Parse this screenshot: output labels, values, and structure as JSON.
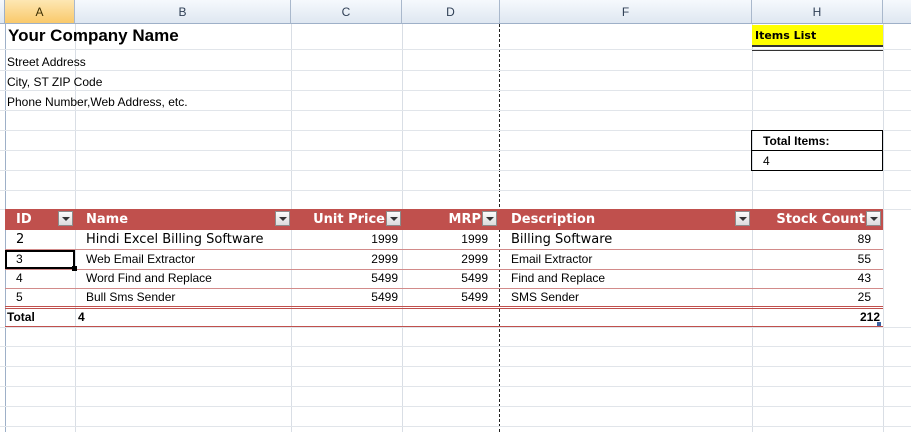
{
  "columns": [
    "A",
    "B",
    "C",
    "D",
    "F",
    "H"
  ],
  "company": {
    "name": "Your Company Name",
    "street": "Street Address",
    "city": "City, ST  ZIP Code",
    "phone": "Phone Number,Web Address, etc."
  },
  "items_list_label": "Items List",
  "total_items": {
    "label": "Total Items:",
    "value": "4"
  },
  "table": {
    "headers": {
      "id": "ID",
      "name": "Name",
      "unit_price": "Unit Price",
      "mrp": "MRP",
      "description": "Description",
      "stock_count": "Stock Count"
    },
    "rows": [
      {
        "id": "2",
        "name": "Hindi Excel Billing Software",
        "unit_price": "1999",
        "mrp": "1999",
        "description": "Billing Software",
        "stock": "89"
      },
      {
        "id": "3",
        "name": "Web Email Extractor",
        "unit_price": "2999",
        "mrp": "2999",
        "description": "Email Extractor",
        "stock": "55"
      },
      {
        "id": "4",
        "name": "Word Find and Replace",
        "unit_price": "5499",
        "mrp": "5499",
        "description": "Find and Replace",
        "stock": "43"
      },
      {
        "id": "5",
        "name": "Bull Sms Sender",
        "unit_price": "5499",
        "mrp": "5499",
        "description": "SMS Sender",
        "stock": "25"
      }
    ],
    "total": {
      "label": "Total",
      "count": "4",
      "stock": "212"
    }
  },
  "colors": {
    "header_fill": "#c0504d",
    "highlight": "#ffff00",
    "selected_column": "#f9c96b"
  }
}
